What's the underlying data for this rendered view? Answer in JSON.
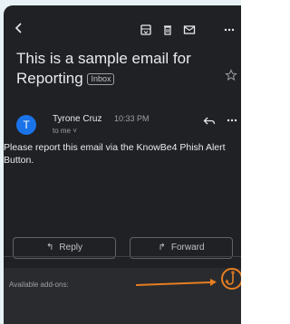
{
  "email": {
    "subject": "This is a sample email for Reporting",
    "label": "Inbox",
    "sender": {
      "initial": "T",
      "name": "Tyrone Cruz",
      "time": "10:33 PM",
      "to": "to me ˅"
    },
    "body": "Please report this email via the KnowBe4 Phish Alert Button."
  },
  "actions": {
    "reply_label": "Reply",
    "forward_label": "Forward"
  },
  "addons": {
    "label": "Available add-ons:"
  },
  "colors": {
    "background": "#202124",
    "avatar": "#1a73e8",
    "annotation": "#e67e22"
  }
}
